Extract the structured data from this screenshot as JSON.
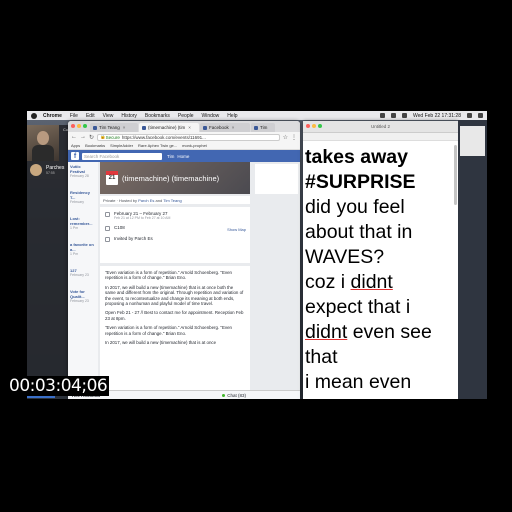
{
  "menubar": {
    "app": "Chrome",
    "items": [
      "File",
      "Edit",
      "View",
      "History",
      "Bookmarks",
      "People",
      "Window",
      "Help"
    ],
    "clock": "Wed Feb 22  17:31:28"
  },
  "call": {
    "status": "Current Call",
    "name": "Parches",
    "duration": "57:55"
  },
  "browser": {
    "tabs": [
      {
        "label": "Tim Teang"
      },
      {
        "label": "(timemachine) (tim"
      },
      {
        "label": "Facebook"
      },
      {
        "label": "Tim"
      }
    ],
    "secure_label": "Secure",
    "url": "https://www.facebook.com/events/11691..."
  },
  "bookmarks": [
    "Apps",
    "Bookmarks",
    "SimpleAdder",
    "Rare Aphex Twin ge...",
    "monk-prophet"
  ],
  "facebook": {
    "logo": "f",
    "search_placeholder": "Search Facebook",
    "user": "Tim",
    "home": "Home"
  },
  "left_rail": [
    {
      "title": "Vutiic Festival",
      "sub": "February 28"
    },
    {
      "title": "Residency T...",
      "sub": "February"
    },
    {
      "title": "Lost: remember...",
      "sub": "1 Pm"
    },
    {
      "title": "a favorite on a...",
      "sub": "1 Pm"
    },
    {
      "title": "127",
      "sub": "February 23"
    },
    {
      "title": "Vote for Qualit...",
      "sub": "February 23"
    }
  ],
  "event": {
    "date_day": "21",
    "title": "(timemachine) (timemachine)",
    "privacy_line": "Private · Hosted by",
    "host_1": "Parch Es",
    "host_and": "and",
    "host_2": "Tim Teang",
    "date_range": "February 21 – February 27",
    "date_sub": "Feb 21 at 12 PM to Feb 27 at 10 AM",
    "location": "C108",
    "show_map": "Show Map",
    "invited_by": "Invited by Parch Es",
    "desc": [
      "\"Even variation is a form of repetition.\" Arnold Schoenberg. \"Even repetition is a form of change.\" Brian Eno.",
      "In 2017, we will build a new (timemachine) that is at once both the same and different from the original. Through repetition and variation of the event, to recontextualize and change its meaning at both ends, proposing a nonhuman and playful model of time travel.",
      "Open Feb 21 - 27 // Best to contact me for appointment. Reception Feb 23 at 8pm.",
      "\"Even variation is a form of repetition.\" Arnold Schoenberg. \"Even repetition is a form of change.\" Brian Eno.",
      "In 2017, we will build a new (timemachine) that is at once"
    ]
  },
  "chatbar": {
    "name": "rele Assolina",
    "chat": "Chat (83)"
  },
  "notes": {
    "title": "Untitled 2",
    "lines": [
      {
        "text": "takes away",
        "style": "bold"
      },
      {
        "text": "#SURPRISE",
        "style": "bold"
      },
      {
        "text": "did you feel",
        "style": "normal"
      },
      {
        "text": "about that in",
        "style": "normal"
      },
      {
        "text": "WAVES?",
        "style": "normal"
      }
    ],
    "line6_pre": "coz i ",
    "line6_ul": "didnt",
    "line7": "expect that i",
    "line8_ul": "didnt",
    "line8_post": " even see",
    "line9": "that",
    "line10": "i mean even"
  },
  "timecode": "00:03:04;06",
  "colors": {
    "facebook_blue": "#4267b2",
    "link_blue": "#365899",
    "end_call_red": "#e13b32",
    "info_blue": "#2d8ff0",
    "spell_underline": "#e03030"
  }
}
